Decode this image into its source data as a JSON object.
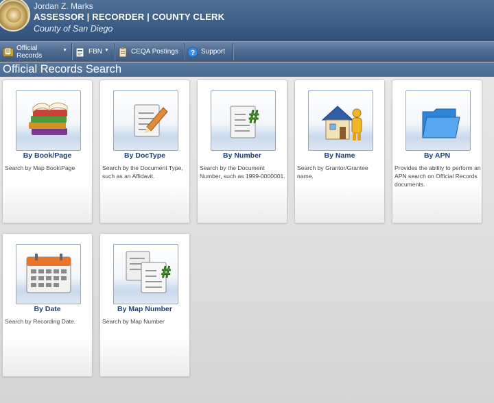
{
  "header": {
    "name": "Jordan Z. Marks",
    "office": "ASSESSOR | RECORDER | COUNTY CLERK",
    "county": "County of San Diego"
  },
  "nav": {
    "items": [
      {
        "label": "Official Records",
        "icon": "book-icon",
        "dropdown": true
      },
      {
        "label": "FBN",
        "icon": "document-icon",
        "dropdown": true
      },
      {
        "label": "CEQA Postings",
        "icon": "clipboard-icon",
        "dropdown": false
      },
      {
        "label": "Support",
        "icon": "help-icon",
        "dropdown": false
      }
    ],
    "caret": "▼"
  },
  "page": {
    "title": "Official Records Search"
  },
  "tiles": [
    {
      "title": "By Book/Page",
      "description": "Search by Map Book\\Page",
      "icon": "stacked-books-icon"
    },
    {
      "title": "By DocType",
      "description": "Search by the Document Type, such as an Affidavit.",
      "icon": "document-pencil-icon"
    },
    {
      "title": "By Number",
      "description": "Search by the Document Number, such as 1999-0000001.",
      "icon": "document-number-icon"
    },
    {
      "title": "By Name",
      "description": "Search by Grantor/Grantee name.",
      "icon": "house-person-icon"
    },
    {
      "title": "By APN",
      "description": "Provides the ability to perform an APN search on Official Records documents.",
      "icon": "folder-icon"
    },
    {
      "title": "By Date",
      "description": "Search by Recording Date.",
      "icon": "calendar-icon"
    },
    {
      "title": "By Map Number",
      "description": "Search by Map Number",
      "icon": "map-documents-icon"
    }
  ],
  "colors": {
    "header": "#3d5f88",
    "tile_title": "#1c3f7c",
    "number_sign": "#4caf2a"
  }
}
